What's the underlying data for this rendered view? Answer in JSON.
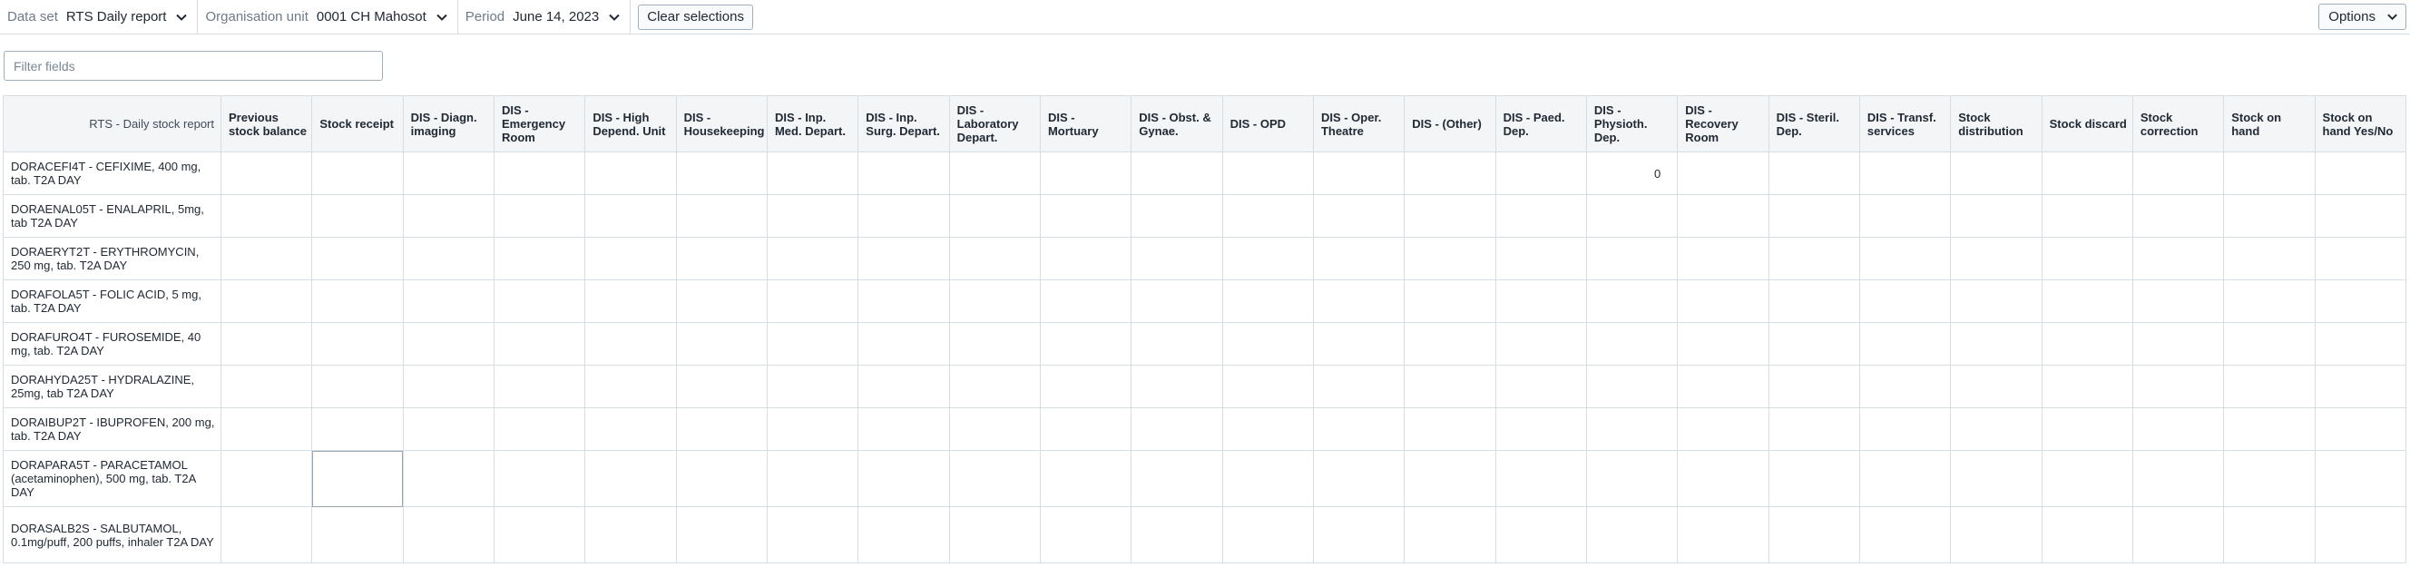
{
  "topbar": {
    "dataset": {
      "label": "Data set",
      "value": "RTS Daily report"
    },
    "orgunit": {
      "label": "Organisation unit",
      "value": "0001 CH Mahosot"
    },
    "period": {
      "label": "Period",
      "value": "June 14, 2023"
    },
    "clear_label": "Clear selections",
    "options_label": "Options"
  },
  "filter": {
    "placeholder": "Filter fields"
  },
  "table": {
    "corner": "RTS - Daily stock report",
    "columns": [
      "Previous stock balance",
      "Stock receipt",
      "DIS - Diagn. imaging",
      "DIS - Emergency Room",
      "DIS - High Depend. Unit",
      "DIS - Housekeeping",
      "DIS - Inp. Med. Depart.",
      "DIS - Inp. Surg. Depart.",
      "DIS - Laboratory Depart.",
      "DIS - Mortuary",
      "DIS - Obst. & Gynae.",
      "DIS - OPD",
      "DIS - Oper. Theatre",
      "DIS - (Other)",
      "DIS - Paed. Dep.",
      "DIS - Physioth. Dep.",
      "DIS - Recovery Room",
      "DIS - Steril. Dep.",
      "DIS - Transf. services",
      "Stock distribution",
      "Stock discard",
      "Stock correction",
      "Stock on hand",
      "Stock on hand Yes/No"
    ],
    "rows": [
      {
        "label": "DORACEFI4T - CEFIXIME, 400 mg, tab. T2A DAY",
        "values": [
          "",
          "",
          "",
          "",
          "",
          "",
          "",
          "",
          "",
          "",
          "",
          "",
          "",
          "",
          "",
          "0",
          "",
          "",
          "",
          "",
          "",
          "",
          "",
          ""
        ]
      },
      {
        "label": "DORAENAL05T - ENALAPRIL, 5mg, tab T2A DAY",
        "values": [
          "",
          "",
          "",
          "",
          "",
          "",
          "",
          "",
          "",
          "",
          "",
          "",
          "",
          "",
          "",
          "",
          "",
          "",
          "",
          "",
          "",
          "",
          "",
          ""
        ]
      },
      {
        "label": "DORAERYT2T - ERYTHROMYCIN, 250 mg, tab. T2A DAY",
        "values": [
          "",
          "",
          "",
          "",
          "",
          "",
          "",
          "",
          "",
          "",
          "",
          "",
          "",
          "",
          "",
          "",
          "",
          "",
          "",
          "",
          "",
          "",
          "",
          ""
        ]
      },
      {
        "label": "DORAFOLA5T - FOLIC ACID, 5 mg, tab. T2A DAY",
        "values": [
          "",
          "",
          "",
          "",
          "",
          "",
          "",
          "",
          "",
          "",
          "",
          "",
          "",
          "",
          "",
          "",
          "",
          "",
          "",
          "",
          "",
          "",
          "",
          ""
        ]
      },
      {
        "label": "DORAFURO4T - FUROSEMIDE, 40 mg, tab. T2A DAY",
        "values": [
          "",
          "",
          "",
          "",
          "",
          "",
          "",
          "",
          "",
          "",
          "",
          "",
          "",
          "",
          "",
          "",
          "",
          "",
          "",
          "",
          "",
          "",
          "",
          ""
        ]
      },
      {
        "label": "DORAHYDA25T - HYDRALAZINE, 25mg, tab T2A DAY",
        "values": [
          "",
          "",
          "",
          "",
          "",
          "",
          "",
          "",
          "",
          "",
          "",
          "",
          "",
          "",
          "",
          "",
          "",
          "",
          "",
          "",
          "",
          "",
          "",
          ""
        ]
      },
      {
        "label": "DORAIBUP2T - IBUPROFEN, 200 mg, tab. T2A DAY",
        "values": [
          "",
          "",
          "",
          "",
          "",
          "",
          "",
          "",
          "",
          "",
          "",
          "",
          "",
          "",
          "",
          "",
          "",
          "",
          "",
          "",
          "",
          "",
          "",
          ""
        ]
      },
      {
        "label": "DORAPARA5T - PARACETAMOL (acetaminophen), 500 mg, tab. T2A DAY",
        "values": [
          "",
          "",
          "",
          "",
          "",
          "",
          "",
          "",
          "",
          "",
          "",
          "",
          "",
          "",
          "",
          "",
          "",
          "",
          "",
          "",
          "",
          "",
          "",
          ""
        ]
      },
      {
        "label": "DORASALB2S - SALBUTAMOL, 0.1mg/puff, 200 puffs, inhaler T2A DAY",
        "values": [
          "",
          "",
          "",
          "",
          "",
          "",
          "",
          "",
          "",
          "",
          "",
          "",
          "",
          "",
          "",
          "",
          "",
          "",
          "",
          "",
          "",
          "",
          "",
          ""
        ]
      }
    ]
  }
}
